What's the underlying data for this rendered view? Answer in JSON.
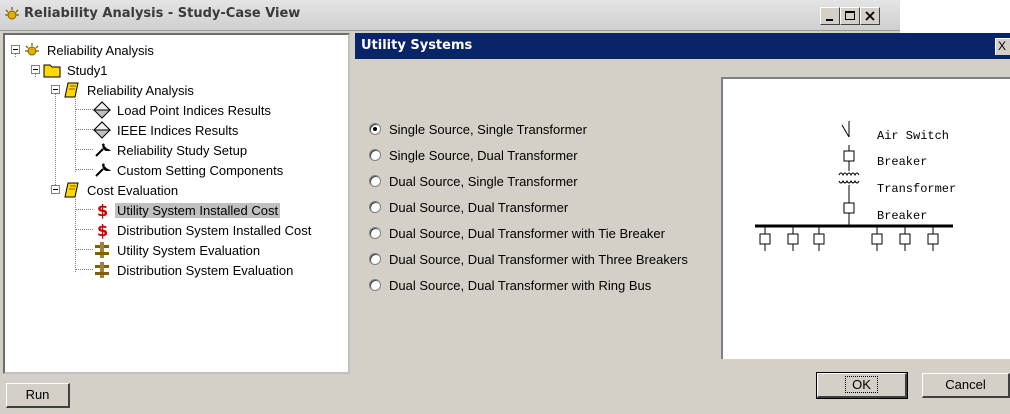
{
  "window": {
    "title": "Reliability Analysis - Study-Case View",
    "app_icon": "reliability-icon",
    "controls": [
      "minimize-icon",
      "maximize-icon",
      "close-icon"
    ]
  },
  "tree": {
    "root": {
      "label": "Reliability Analysis",
      "icon": "reliability-icon"
    },
    "study": {
      "label": "Study1",
      "icon": "folder-icon"
    },
    "reliability_group": {
      "label": "Reliability Analysis",
      "icon": "book-icon",
      "items": [
        {
          "label": "Load Point Indices Results",
          "icon": "diamond-icon"
        },
        {
          "label": "IEEE Indices Results",
          "icon": "diamond-icon"
        },
        {
          "label": "Reliability Study Setup",
          "icon": "wrench-icon"
        },
        {
          "label": "Custom Setting Components",
          "icon": "wrench-icon"
        }
      ]
    },
    "cost_group": {
      "label": "Cost Evaluation",
      "icon": "book-icon",
      "items": [
        {
          "label": "Utility System Installed Cost",
          "icon": "dollar-icon",
          "selected": true
        },
        {
          "label": "Distribution System Installed Cost",
          "icon": "dollar-icon"
        },
        {
          "label": "Utility System Evaluation",
          "icon": "substation-icon"
        },
        {
          "label": "Distribution System Evaluation",
          "icon": "substation-icon"
        }
      ]
    }
  },
  "run_button": "Run",
  "dialog": {
    "title": "Utility Systems",
    "close_glyph": "X",
    "options": [
      {
        "label": "Single Source, Single Transformer",
        "checked": true
      },
      {
        "label": "Single Source, Dual Transformer",
        "checked": false
      },
      {
        "label": "Dual Source, Single Transformer",
        "checked": false
      },
      {
        "label": "Dual Source, Dual Transformer",
        "checked": false
      },
      {
        "label": "Dual Source, Dual Transformer with Tie Breaker",
        "checked": false
      },
      {
        "label": "Dual Source, Dual Transformer with Three Breakers",
        "checked": false
      },
      {
        "label": "Dual Source, Dual Transformer with Ring Bus",
        "checked": false
      }
    ],
    "diagram_labels": {
      "air_switch": "Air Switch",
      "breaker_top": "Breaker",
      "transformer": "Transformer",
      "breaker_bottom": "Breaker"
    },
    "ok": "OK",
    "cancel": "Cancel"
  },
  "colors": {
    "dialog_title_bg": "#0a246a",
    "chrome": "#d4d0c8",
    "dollar": "#cc0000"
  }
}
